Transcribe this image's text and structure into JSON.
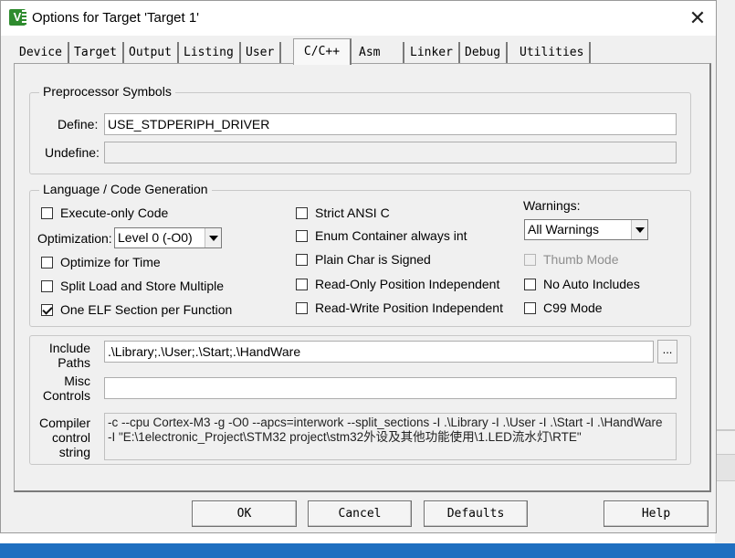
{
  "window": {
    "title": "Options for Target 'Target 1'",
    "icon": "keil-uvision-icon",
    "close_glyph": "✕"
  },
  "tabs": [
    {
      "label": "Device",
      "active": false
    },
    {
      "label": "Target",
      "active": false
    },
    {
      "label": "Output",
      "active": false
    },
    {
      "label": "Listing",
      "active": false
    },
    {
      "label": "User",
      "active": false
    },
    {
      "label": "C/C++",
      "active": true
    },
    {
      "label": "Asm",
      "active": false
    },
    {
      "label": "Linker",
      "active": false
    },
    {
      "label": "Debug",
      "active": false
    },
    {
      "label": "Utilities",
      "active": false
    }
  ],
  "preprocessor": {
    "title": "Preprocessor Symbols",
    "define_label": "Define:",
    "define_value": "USE_STDPERIPH_DRIVER",
    "undefine_label": "Undefine:",
    "undefine_value": ""
  },
  "language": {
    "title": "Language / Code Generation",
    "execute_only": {
      "label": "Execute-only Code",
      "checked": false
    },
    "optimization_label": "Optimization:",
    "optimization_value": "Level 0 (-O0)",
    "optimize_time": {
      "label": "Optimize for Time",
      "checked": false
    },
    "split_load": {
      "label": "Split Load and Store Multiple",
      "checked": false
    },
    "one_elf": {
      "label": "One ELF Section per Function",
      "checked": true
    },
    "strict_ansi": {
      "label": "Strict ANSI C",
      "checked": false
    },
    "enum_container": {
      "label": "Enum Container always int",
      "checked": false
    },
    "plain_char": {
      "label": "Plain Char is Signed",
      "checked": false
    },
    "ro_position": {
      "label": "Read-Only Position Independent",
      "checked": false
    },
    "rw_position": {
      "label": "Read-Write Position Independent",
      "checked": false
    },
    "warnings_label": "Warnings:",
    "warnings_value": "All Warnings",
    "thumb_mode": {
      "label": "Thumb Mode",
      "checked": false,
      "disabled": true
    },
    "no_auto_includes": {
      "label": "No Auto Includes",
      "checked": false
    },
    "c99_mode": {
      "label": "C99 Mode",
      "checked": false
    }
  },
  "paths": {
    "include_label_1": "Include",
    "include_label_2": "Paths",
    "include_value": ".\\Library;.\\User;.\\Start;.\\HandWare",
    "browse_label": "...",
    "misc_label_1": "Misc",
    "misc_label_2": "Controls",
    "misc_value": "",
    "compiler_label_1": "Compiler",
    "compiler_label_2": "control",
    "compiler_label_3": "string",
    "compiler_line_1": "-c --cpu Cortex-M3 -g -O0 --apcs=interwork --split_sections -I .\\Library -I .\\User -I .\\Start -I .\\HandWare",
    "compiler_line_2": "-I \"E:\\1electronic_Project\\STM32 project\\stm32外设及其他功能使用\\1.LED流水灯\\RTE\""
  },
  "buttons": {
    "ok": "OK",
    "cancel": "Cancel",
    "defaults": "Defaults",
    "help": "Help"
  }
}
